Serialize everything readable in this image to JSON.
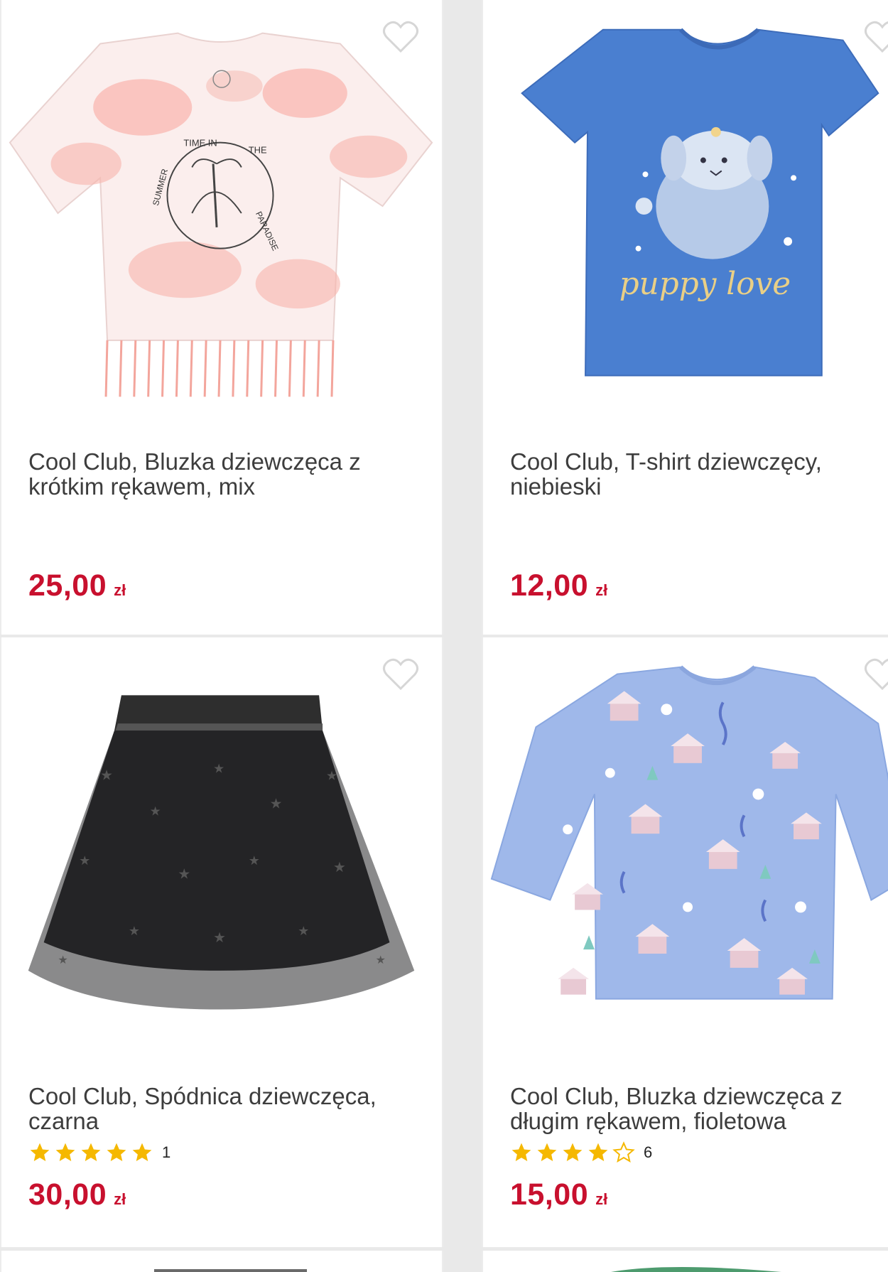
{
  "products": [
    {
      "title": "Cool Club, Bluzka dziewczęca z krótkim rękawem, mix",
      "price": "25,00",
      "currency": "zł",
      "print_text": [
        "TIME IN",
        "THE",
        "SUMMER",
        "PARADISE"
      ]
    },
    {
      "title": "Cool Club, T-shirt dziewczęcy, niebieski",
      "price": "12,00",
      "currency": "zł",
      "print_text": [
        "puppy love"
      ]
    },
    {
      "title": "Cool Club, Spódnica dziewczęca, czarna",
      "price": "30,00",
      "currency": "zł",
      "rating": {
        "stars": 5,
        "max": 5,
        "count": "1"
      }
    },
    {
      "title": "Cool Club, Bluzka dziewczęca z długim rękawem, fioletowa",
      "price": "15,00",
      "currency": "zł",
      "rating": {
        "stars": 4,
        "max": 5,
        "count": "6"
      }
    }
  ],
  "colors": {
    "price": "#c8102e",
    "title": "#3d3d3d",
    "star": "#f5b800",
    "background": "#e9e9e9",
    "card": "#ffffff"
  },
  "icons": {
    "wishlist": "heart-outline-icon",
    "rating_full": "star-filled-icon",
    "rating_empty": "star-outline-icon"
  }
}
